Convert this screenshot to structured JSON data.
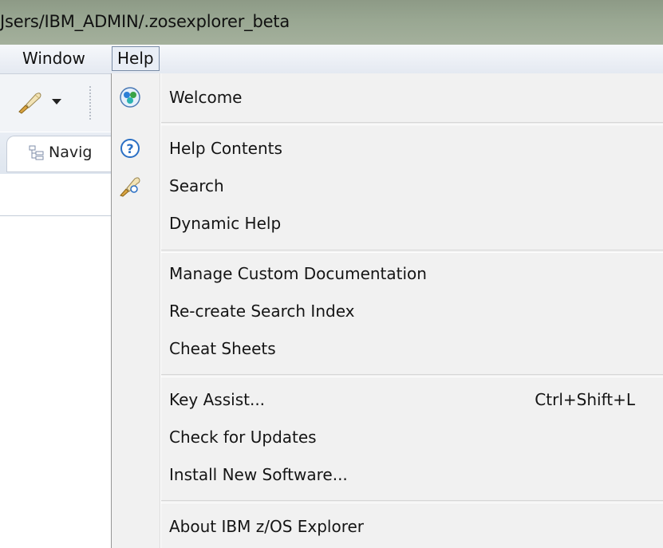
{
  "window": {
    "title": "Jsers/IBM_ADMIN/.zosexplorer_beta"
  },
  "menubar": {
    "items": [
      {
        "label": "Window"
      },
      {
        "label": "Help",
        "active": true
      }
    ]
  },
  "toolbar": {
    "tool_icon": "brush-icon",
    "dropdown_icon": "chevron-down-icon"
  },
  "view": {
    "tab_label": "Navig",
    "tab_icon": "navigator-icon"
  },
  "help_menu": {
    "items": [
      {
        "label": "Welcome",
        "icon": "welcome-icon",
        "accel": ""
      },
      {
        "label": "Help Contents",
        "icon": "help-contents-icon",
        "accel": ""
      },
      {
        "label": "Search",
        "icon": "search-icon",
        "accel": ""
      },
      {
        "label": "Dynamic Help",
        "icon": "",
        "accel": ""
      },
      {
        "label": "Manage Custom Documentation",
        "icon": "",
        "accel": ""
      },
      {
        "label": "Re-create Search Index",
        "icon": "",
        "accel": ""
      },
      {
        "label": "Cheat Sheets",
        "icon": "",
        "accel": ""
      },
      {
        "label": "Key Assist...",
        "icon": "",
        "accel": "Ctrl+Shift+L"
      },
      {
        "label": "Check for Updates",
        "icon": "",
        "accel": ""
      },
      {
        "label": "Install New Software...",
        "icon": "",
        "accel": ""
      },
      {
        "label": "About IBM z/OS Explorer",
        "icon": "",
        "accel": ""
      }
    ]
  },
  "colors": {
    "titlebar": "#99a792",
    "menu_background": "#f1f1f1",
    "menubar": "#e4e9f1",
    "help_blue": "#2a6fc4"
  }
}
